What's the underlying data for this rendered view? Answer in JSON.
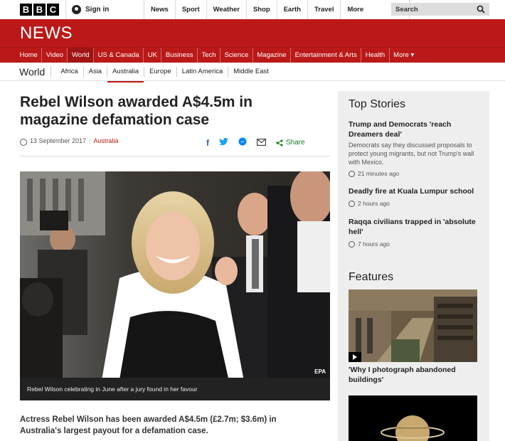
{
  "brand": {
    "letters": [
      "B",
      "B",
      "C"
    ],
    "news": "NEWS"
  },
  "signin": {
    "label": "Sign in"
  },
  "topnav": [
    "News",
    "Sport",
    "Weather",
    "Shop",
    "Earth",
    "Travel",
    "More"
  ],
  "search": {
    "placeholder": "Search"
  },
  "rednav": [
    "Home",
    "Video",
    "World",
    "US & Canada",
    "UK",
    "Business",
    "Tech",
    "Science",
    "Magazine",
    "Entertainment & Arts",
    "Health",
    "More ▾"
  ],
  "subnav": {
    "section": "World",
    "items": [
      "Africa",
      "Asia",
      "Australia",
      "Europe",
      "Latin America",
      "Middle East"
    ]
  },
  "article": {
    "headline": "Rebel Wilson awarded A$4.5m in magazine defamation case",
    "date": "13 September 2017",
    "category": "Australia",
    "share_label": "Share",
    "caption": "Rebel Wilson celebrating in June after a jury found in her favour",
    "credit": "EPA",
    "intro": "Actress Rebel Wilson has been awarded A$4.5m (£2.7m; $3.6m) in Australia's largest payout for a defamation case."
  },
  "sidebar": {
    "top_stories_title": "Top Stories",
    "stories": [
      {
        "title": "Trump and Democrats 'reach Dreamers deal'",
        "summary": "Democrats say they discussed proposals to protect young migrants, but not Trump's wall with Mexico.",
        "time": "21 minutes ago"
      },
      {
        "title": "Deadly fire at Kuala Lumpur school",
        "time": "2 hours ago"
      },
      {
        "title": "Raqqa civilians trapped in 'absolute hell'",
        "time": "7 hours ago"
      }
    ],
    "features_title": "Features",
    "features": [
      {
        "title": "'Why I photograph abandoned buildings'"
      }
    ]
  },
  "colors": {
    "bbc_red": "#bb1919",
    "share_green": "#1a7a2a",
    "sidebar_bg": "#eeeeee"
  }
}
